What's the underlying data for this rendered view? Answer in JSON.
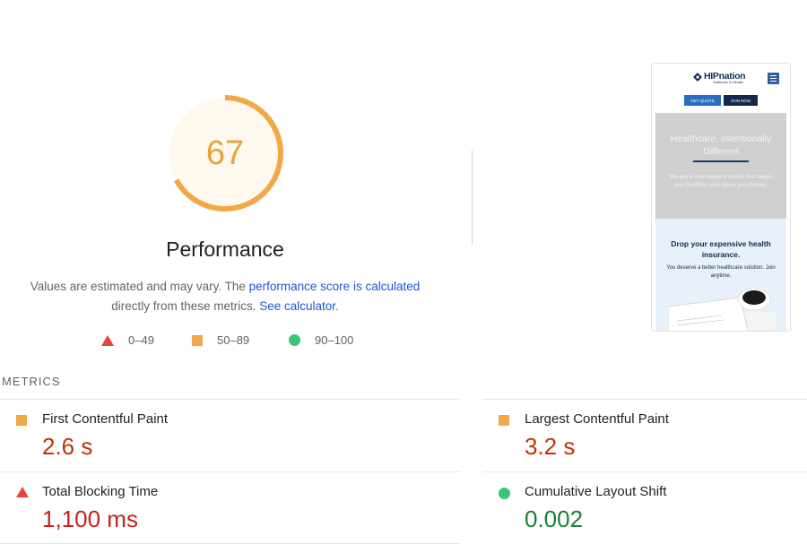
{
  "performance": {
    "score": "67",
    "score_fraction": 0.67,
    "title": "Performance",
    "description_prefix": "Values are estimated and may vary. The ",
    "description_link1": "performance score is calculated",
    "description_mid": " directly from these metrics. ",
    "description_link2": "See calculator",
    "description_suffix": ".",
    "color": "#f0a946"
  },
  "legend": [
    {
      "icon": "triangle-icon",
      "label": "0–49",
      "color": "#e6443a"
    },
    {
      "icon": "square-icon",
      "label": "50–89",
      "color": "#f0a946"
    },
    {
      "icon": "circle-icon",
      "label": "90–100",
      "color": "#3cc472"
    }
  ],
  "screenshot": {
    "logo": "HIPnation",
    "logo_sub": "Healthcare & Lifestyle",
    "btn_quote": "GET QUOTE",
    "btn_join": "JOIN NOW",
    "hero_title": "Healthcare, Intentionally Different",
    "hero_text": "We are a new delivery model that keeps you healthier and saves you money.",
    "section_title": "Drop your expensive health insurance.",
    "section_text": "You deserve a better healthcare solution. Join anytime."
  },
  "metrics": {
    "title": "METRICS",
    "items": [
      {
        "label": "First Contentful Paint",
        "value": "2.6 s",
        "status": "average"
      },
      {
        "label": "Largest Contentful Paint",
        "value": "3.2 s",
        "status": "average"
      },
      {
        "label": "Total Blocking Time",
        "value": "1,100 ms",
        "status": "fail"
      },
      {
        "label": "Cumulative Layout Shift",
        "value": "0.002",
        "status": "pass"
      }
    ]
  }
}
